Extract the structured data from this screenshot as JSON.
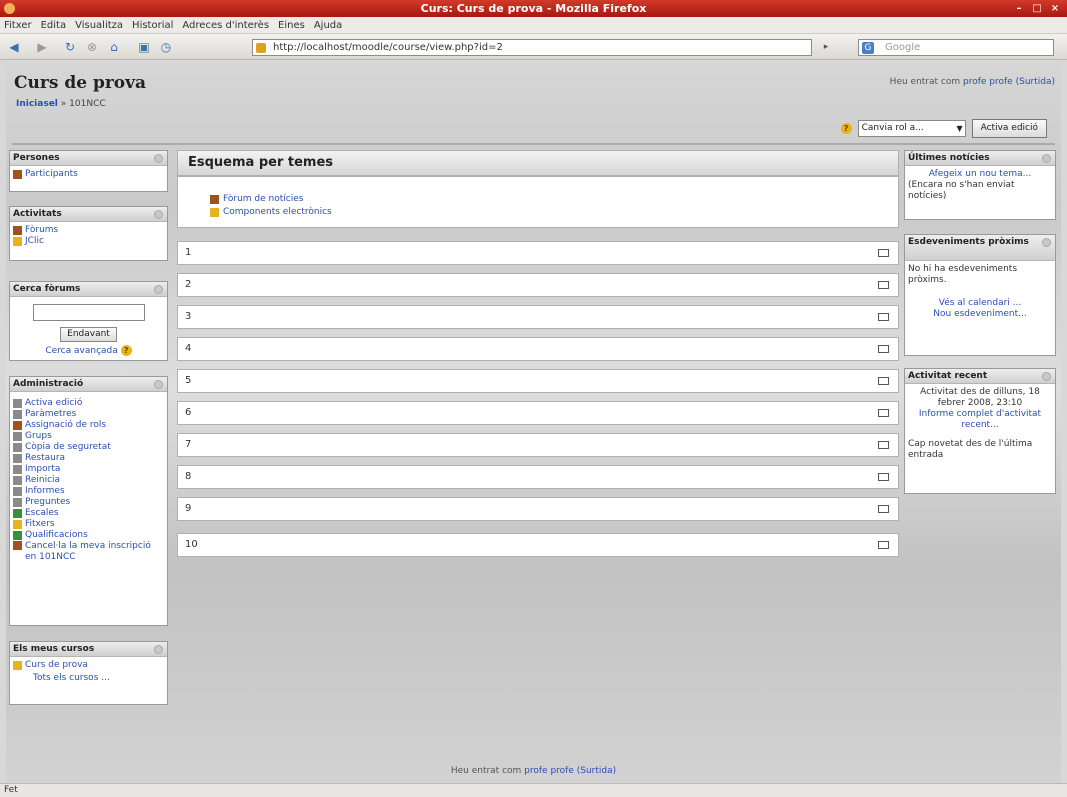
{
  "window": {
    "title": "Curs: Curs de prova - Mozilla Firefox"
  },
  "menu": [
    "Fitxer",
    "Edita",
    "Visualitza",
    "Historial",
    "Adreces d'interès",
    "Eines",
    "Ajuda"
  ],
  "toolbar": {
    "url": "http://localhost/moodle/course/view.php?id=2",
    "search_placeholder": "Google"
  },
  "header": {
    "course_title": "Curs de prova",
    "breadcrumb_root": "Iniciasel",
    "breadcrumb_sep": "»",
    "breadcrumb_course": "101NCC",
    "login_prefix": "Heu entrat com ",
    "login_user": "profe profe",
    "login_logout": "(Surtida)",
    "role_select": "Canvia rol a...",
    "edit_button": "Activa edició"
  },
  "blocks_left": {
    "persones": {
      "title": "Persones",
      "items": [
        "Participants"
      ]
    },
    "activitats": {
      "title": "Activitats",
      "items": [
        "Fòrums",
        "JClic"
      ]
    },
    "cerca": {
      "title": "Cerca fòrums",
      "button": "Endavant",
      "advanced": "Cerca avançada"
    },
    "admin": {
      "title": "Administració",
      "items": [
        "Activa edició",
        "Paràmetres",
        "Assignació de rols",
        "Grups",
        "Còpia de seguretat",
        "Restaura",
        "Importa",
        "Reinicia",
        "Informes",
        "Preguntes",
        "Escales",
        "Fitxers",
        "Qualificacions",
        "Cancel·la la meva inscripció en 101NCC"
      ]
    },
    "cursos": {
      "title": "Els meus cursos",
      "items": [
        "Curs de prova"
      ],
      "all": "Tots els cursos ..."
    }
  },
  "main": {
    "title": "Esquema per temes",
    "topic0": [
      "Fòrum de notícies",
      "Components electrònics"
    ],
    "topics": [
      "1",
      "2",
      "3",
      "4",
      "5",
      "6",
      "7",
      "8",
      "9",
      "10"
    ]
  },
  "blocks_right": {
    "noticies": {
      "title": "Últimes notícies",
      "add": "Afegeix un nou tema...",
      "none": "(Encara no s'han enviat notícies)"
    },
    "esdeveniments": {
      "title": "Esdeveniments pròxims",
      "none": "No hi ha esdeveniments pròxims.",
      "calendar": "Vés al calendari ...",
      "new_event": "Nou esdeveniment..."
    },
    "recent": {
      "title": "Activitat recent",
      "since": "Activitat des de dilluns, 18 febrer 2008, 23:10",
      "report": "Informe complet d'activitat recent...",
      "nothing": "Cap novetat des de l'última entrada"
    }
  },
  "footer": {
    "prefix": "Heu entrat com ",
    "user": "profe profe",
    "logout": "(Surtida)"
  },
  "status": {
    "text": "Fet"
  }
}
